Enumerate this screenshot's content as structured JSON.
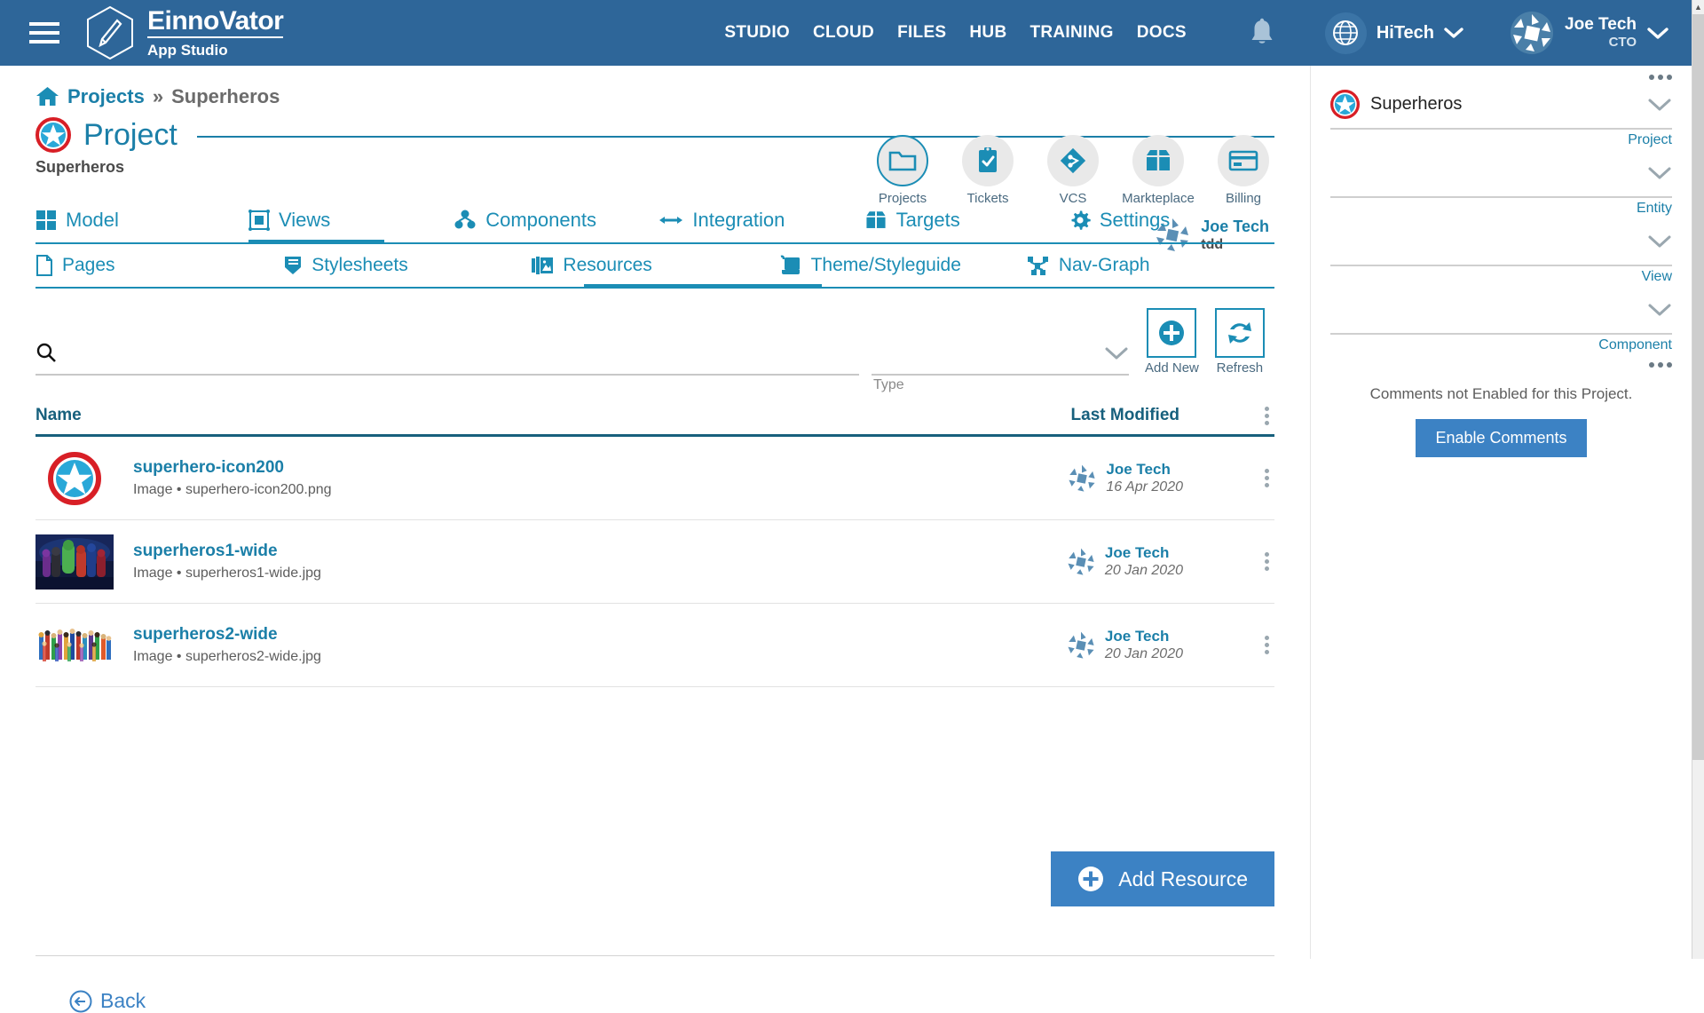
{
  "topbar": {
    "menu_icon": "hamburger-icon",
    "logo_icon": "pencil-hexagon-icon",
    "brand_name": "EinnoVator",
    "brand_sub": "App Studio",
    "nav_links": [
      "STUDIO",
      "CLOUD",
      "FILES",
      "HUB",
      "TRAINING",
      "DOCS"
    ],
    "bell_icon": "notification-bell-icon",
    "globe_icon": "globe-icon",
    "org_name": "HiTech",
    "user_name": "Joe Tech",
    "user_role": "CTO",
    "chevron_icon": "chevron-down-icon"
  },
  "breadcrumb": {
    "home_icon": "home-icon",
    "root": "Projects",
    "separator": "»",
    "current": "Superheros"
  },
  "project": {
    "badge_icon": "superhero-shield-icon",
    "title": "Project",
    "subtitle": "Superheros",
    "owner_name": "Joe Tech",
    "owner_sub": "tdd",
    "owner_avatar": "joe-tech-avatar"
  },
  "quickbar": [
    {
      "label": "Projects",
      "icon": "folder-icon",
      "active": true
    },
    {
      "label": "Tickets",
      "icon": "clipboard-check-icon",
      "active": false
    },
    {
      "label": "VCS",
      "icon": "git-branch-icon",
      "active": false
    },
    {
      "label": "Markteplace",
      "icon": "box-icon",
      "active": false
    },
    {
      "label": "Billing",
      "icon": "credit-card-icon",
      "active": false
    }
  ],
  "tabs": [
    {
      "label": "Model",
      "icon": "grid-icon",
      "active": false
    },
    {
      "label": "Views",
      "icon": "view-frame-icon",
      "active": true
    },
    {
      "label": "Components",
      "icon": "components-icon",
      "active": false
    },
    {
      "label": "Integration",
      "icon": "arrows-horizontal-icon",
      "active": false
    },
    {
      "label": "Targets",
      "icon": "box-icon",
      "active": false
    },
    {
      "label": "Settings",
      "icon": "gear-icon",
      "active": false
    }
  ],
  "subtabs": [
    {
      "label": "Pages",
      "icon": "page-icon",
      "active": false
    },
    {
      "label": "Stylesheets",
      "icon": "stylesheet-icon",
      "active": false
    },
    {
      "label": "Resources",
      "icon": "images-icon",
      "active": true
    },
    {
      "label": "Theme/Styleguide",
      "icon": "theme-scroll-icon",
      "active": false
    },
    {
      "label": "Nav-Graph",
      "icon": "nav-graph-icon",
      "active": false
    }
  ],
  "toolbar": {
    "search_icon": "search-icon",
    "search_value": "",
    "search_placeholder": "",
    "type_label": "Type",
    "type_value": "",
    "type_chevron": "chevron-down-icon",
    "add_new_label": "Add New",
    "add_new_icon": "plus-circle-icon",
    "refresh_label": "Refresh",
    "refresh_icon": "refresh-icon"
  },
  "table": {
    "col_name": "Name",
    "col_modified": "Last Modified",
    "kebab_icon": "kebab-menu-icon",
    "rows": [
      {
        "title": "superhero-icon200",
        "subtitle": "Image • superhero-icon200.png",
        "thumb": "superhero-shield-thumb",
        "modified_by": "Joe Tech",
        "modified_date": "16 Apr 2020",
        "avatar": "joe-tech-avatar"
      },
      {
        "title": "superheros1-wide",
        "subtitle": "Image • superheros1-wide.jpg",
        "thumb": "superheros1-wide-thumb",
        "modified_by": "Joe Tech",
        "modified_date": "20 Jan 2020",
        "avatar": "joe-tech-avatar"
      },
      {
        "title": "superheros2-wide",
        "subtitle": "Image • superheros2-wide.jpg",
        "thumb": "superheros2-wide-thumb",
        "modified_by": "Joe Tech",
        "modified_date": "20 Jan 2020",
        "avatar": "joe-tech-avatar"
      }
    ]
  },
  "footer": {
    "add_resource_label": "Add Resource",
    "add_resource_icon": "plus-circle-icon",
    "back_label": "Back",
    "back_icon": "arrow-left-circle-icon"
  },
  "rightpanel": {
    "dots_icon": "more-options-icon",
    "selectors": [
      {
        "value": "Superheros",
        "caption": "Project",
        "has_badge": true
      },
      {
        "value": "",
        "caption": "Entity",
        "has_badge": false
      },
      {
        "value": "",
        "caption": "View",
        "has_badge": false
      },
      {
        "value": "",
        "caption": "Component",
        "has_badge": false
      }
    ],
    "comments_note": "Comments not Enabled for this Project.",
    "enable_comments_label": "Enable Comments"
  },
  "colors": {
    "topbar_blue": "#2e6699",
    "accent_teal": "#1b8db5",
    "link_blue": "#1b7fa8",
    "button_blue": "#3c82c4",
    "header_rule": "#17607d"
  }
}
